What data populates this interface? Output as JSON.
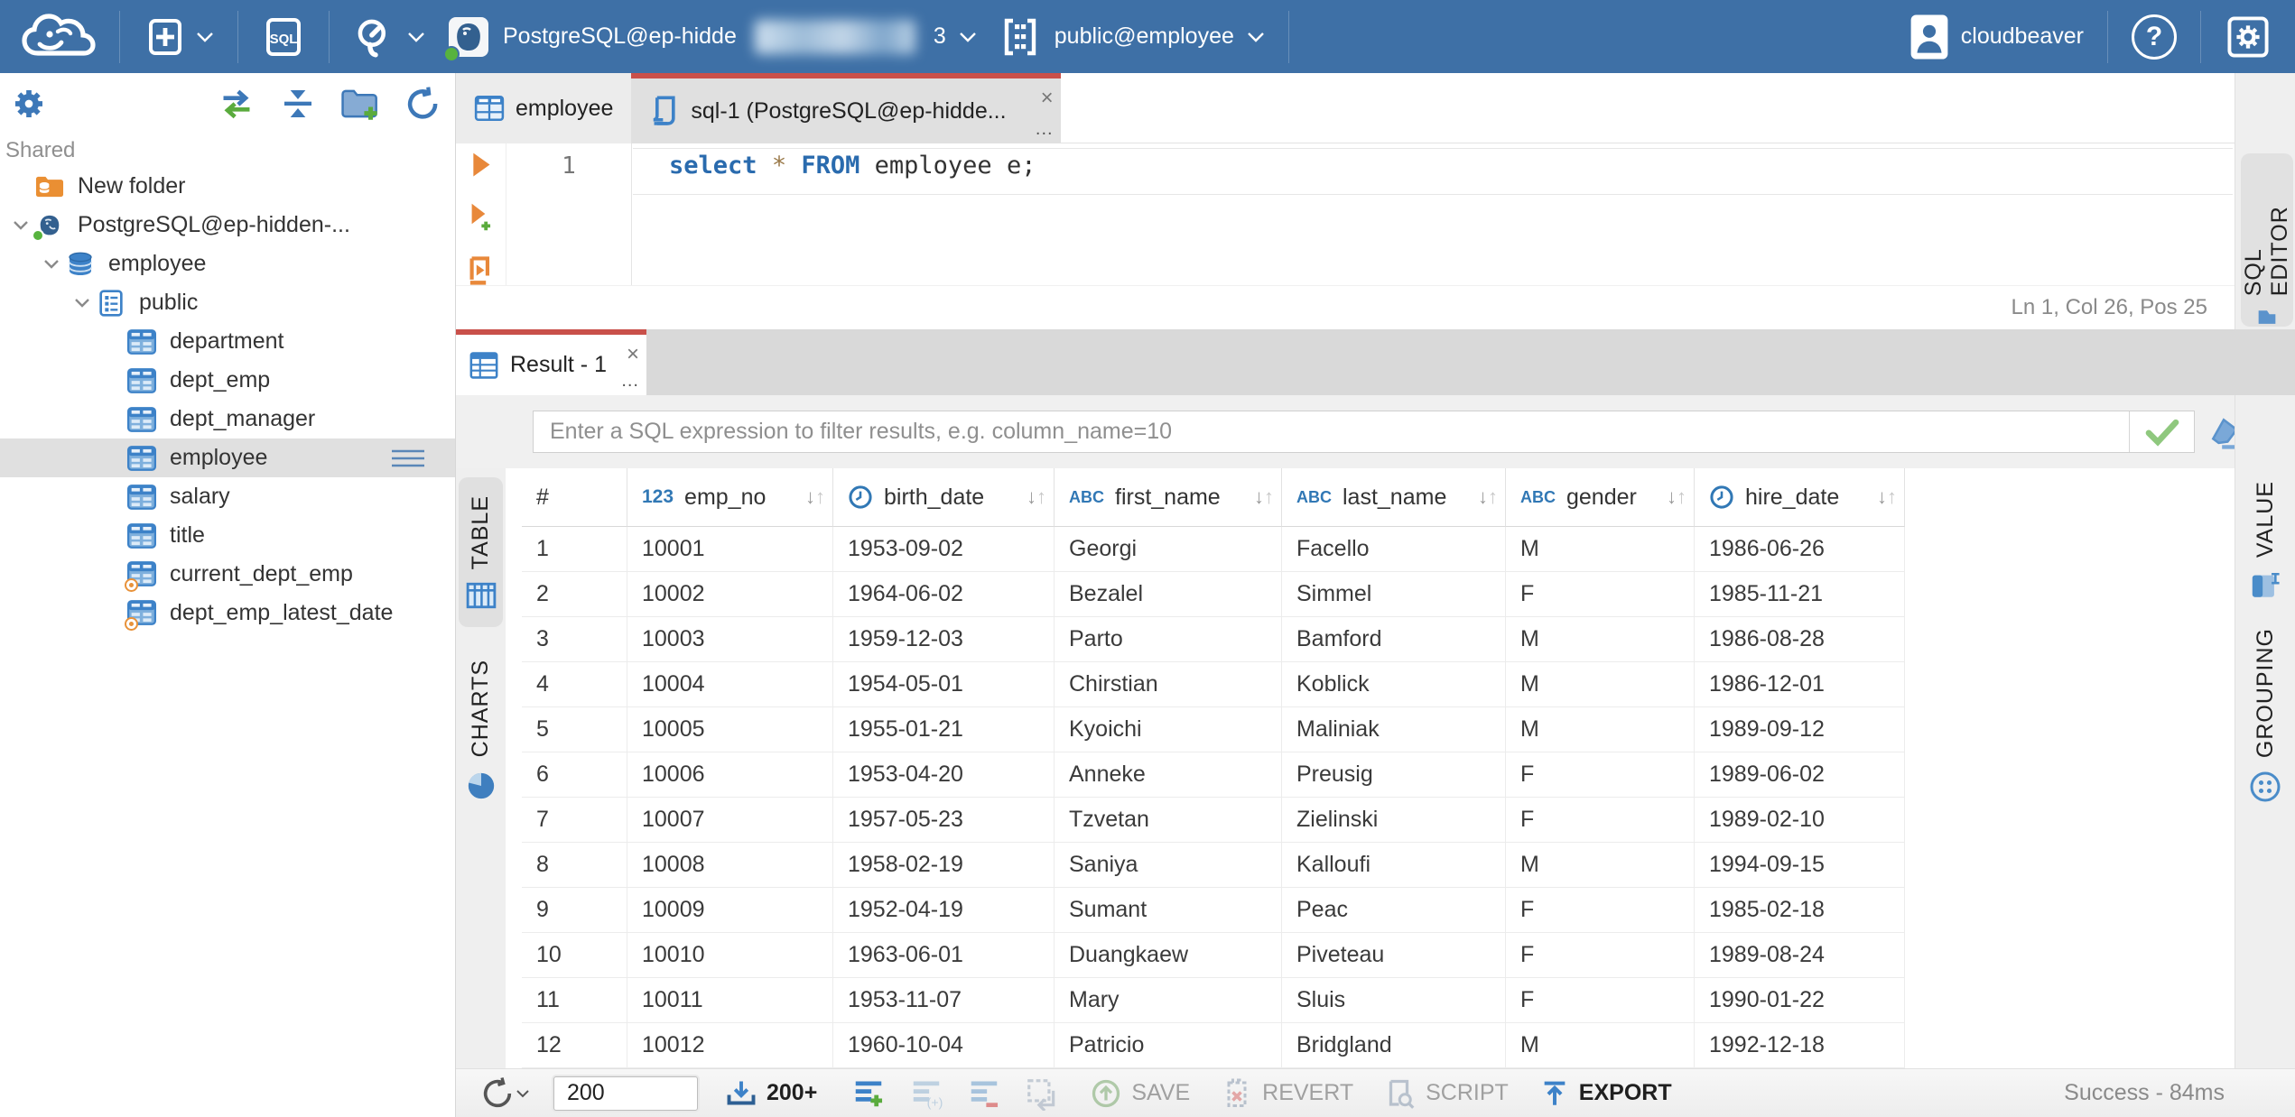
{
  "topbar": {
    "app": "cloudbeaver",
    "connection": {
      "label": "PostgreSQL@ep-hidde",
      "masked_tail": "3"
    },
    "schema_selector": {
      "label": "public@employee"
    },
    "user": {
      "name": "cloudbeaver"
    }
  },
  "sidebar": {
    "section_label": "Shared",
    "tree": [
      {
        "label": "New folder",
        "icon": "folder-db",
        "level": 0,
        "expander": false,
        "selected": false
      },
      {
        "label": "PostgreSQL@ep-hidden-...",
        "icon": "postgres",
        "level": 0,
        "expander": true,
        "selected": false
      },
      {
        "label": "employee",
        "icon": "database",
        "level": 1,
        "expander": true,
        "selected": false
      },
      {
        "label": "public",
        "icon": "schema",
        "level": 2,
        "expander": true,
        "selected": false
      },
      {
        "label": "department",
        "icon": "table",
        "level": 3,
        "expander": false,
        "selected": false
      },
      {
        "label": "dept_emp",
        "icon": "table",
        "level": 3,
        "expander": false,
        "selected": false
      },
      {
        "label": "dept_manager",
        "icon": "table",
        "level": 3,
        "expander": false,
        "selected": false
      },
      {
        "label": "employee",
        "icon": "table",
        "level": 3,
        "expander": false,
        "selected": true
      },
      {
        "label": "salary",
        "icon": "table",
        "level": 3,
        "expander": false,
        "selected": false
      },
      {
        "label": "title",
        "icon": "table",
        "level": 3,
        "expander": false,
        "selected": false
      },
      {
        "label": "current_dept_emp",
        "icon": "view",
        "level": 3,
        "expander": false,
        "selected": false
      },
      {
        "label": "dept_emp_latest_date",
        "icon": "view",
        "level": 3,
        "expander": false,
        "selected": false
      }
    ]
  },
  "tabs": {
    "table_tab": "employee",
    "sql_tab": "sql-1 (PostgreSQL@ep-hidde...",
    "overflow": "..."
  },
  "editor": {
    "line_number": "1",
    "code": {
      "kw1": "select",
      "star": "*",
      "kw2": "FROM",
      "rest": "employee e;"
    },
    "status": "Ln 1, Col 26, Pos 25"
  },
  "result": {
    "tab_label": "Result - 1",
    "overflow": "...",
    "filter_placeholder": "Enter a SQL expression to filter results, e.g. column_name=10",
    "left_tabs": {
      "table": "TABLE",
      "charts": "CHARTS"
    },
    "right_tabs": {
      "sql_editor": "SQL EDITOR",
      "value": "VALUE",
      "grouping": "GROUPING"
    }
  },
  "grid": {
    "index_header": "#",
    "columns": [
      {
        "name": "emp_no",
        "type": "123"
      },
      {
        "name": "birth_date",
        "type": "clock"
      },
      {
        "name": "first_name",
        "type": "abc"
      },
      {
        "name": "last_name",
        "type": "abc"
      },
      {
        "name": "gender",
        "type": "abc"
      },
      {
        "name": "hire_date",
        "type": "clock"
      }
    ],
    "rows": [
      [
        "10001",
        "1953-09-02",
        "Georgi",
        "Facello",
        "M",
        "1986-06-26"
      ],
      [
        "10002",
        "1964-06-02",
        "Bezalel",
        "Simmel",
        "F",
        "1985-11-21"
      ],
      [
        "10003",
        "1959-12-03",
        "Parto",
        "Bamford",
        "M",
        "1986-08-28"
      ],
      [
        "10004",
        "1954-05-01",
        "Chirstian",
        "Koblick",
        "M",
        "1986-12-01"
      ],
      [
        "10005",
        "1955-01-21",
        "Kyoichi",
        "Maliniak",
        "M",
        "1989-09-12"
      ],
      [
        "10006",
        "1953-04-20",
        "Anneke",
        "Preusig",
        "F",
        "1989-06-02"
      ],
      [
        "10007",
        "1957-05-23",
        "Tzvetan",
        "Zielinski",
        "F",
        "1989-02-10"
      ],
      [
        "10008",
        "1958-02-19",
        "Saniya",
        "Kalloufi",
        "M",
        "1994-09-15"
      ],
      [
        "10009",
        "1952-04-19",
        "Sumant",
        "Peac",
        "F",
        "1985-02-18"
      ],
      [
        "10010",
        "1963-06-01",
        "Duangkaew",
        "Piveteau",
        "F",
        "1989-08-24"
      ],
      [
        "10011",
        "1953-11-07",
        "Mary",
        "Sluis",
        "F",
        "1990-01-22"
      ],
      [
        "10012",
        "1960-10-04",
        "Patricio",
        "Bridgland",
        "M",
        "1992-12-18"
      ]
    ]
  },
  "footer": {
    "fetch_size": "200",
    "fetch_more": "200+",
    "save": "SAVE",
    "revert": "REVERT",
    "script": "SCRIPT",
    "export": "EXPORT",
    "status": "Success - 84ms"
  },
  "colors": {
    "topbar": "#3e70a6",
    "accent_red": "#c9504a",
    "icon_blue": "#3d78b8",
    "green": "#5aab3d"
  }
}
